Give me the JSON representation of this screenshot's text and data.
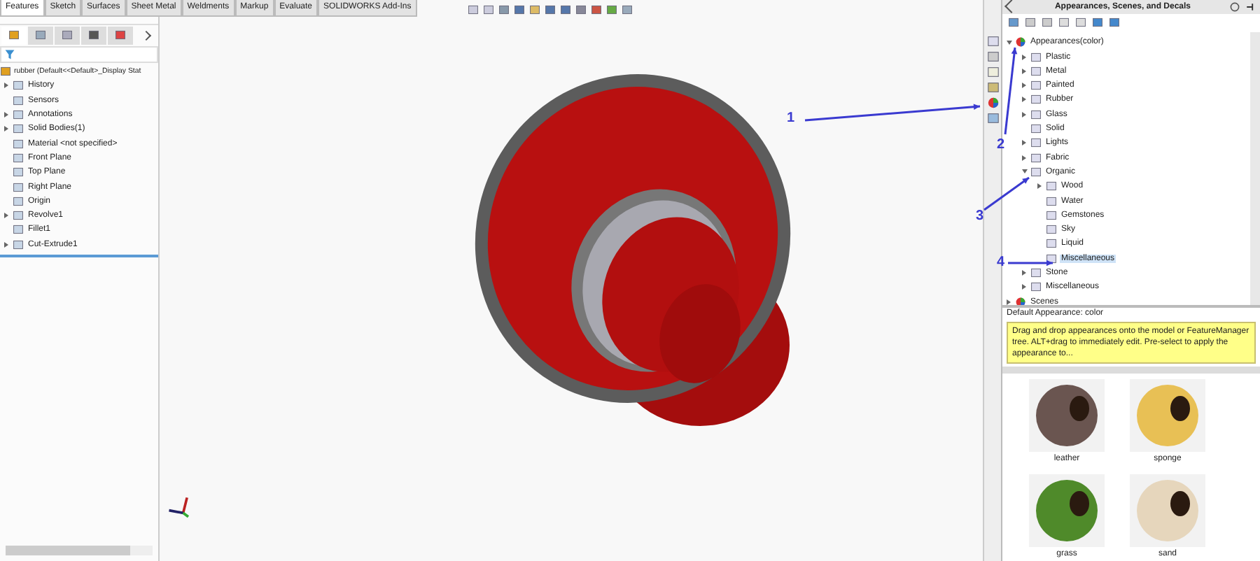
{
  "command_tabs": [
    {
      "label": "Features",
      "selected": true
    },
    {
      "label": "Sketch",
      "selected": false
    },
    {
      "label": "Surfaces",
      "selected": false
    },
    {
      "label": "Sheet Metal",
      "selected": false
    },
    {
      "label": "Weldments",
      "selected": false
    },
    {
      "label": "Markup",
      "selected": false
    },
    {
      "label": "Evaluate",
      "selected": false
    },
    {
      "label": "SOLIDWORKS Add-Ins",
      "selected": false
    }
  ],
  "feature_tree": {
    "root": "rubber  (Default<<Default>_Display Stat",
    "items": [
      {
        "label": "History",
        "kind": "collapsed"
      },
      {
        "label": "Sensors",
        "kind": "leaf"
      },
      {
        "label": "Annotations",
        "kind": "collapsed"
      },
      {
        "label": "Solid Bodies(1)",
        "kind": "collapsed"
      },
      {
        "label": "Material <not specified>",
        "kind": "leaf"
      },
      {
        "label": "Front Plane",
        "kind": "leaf"
      },
      {
        "label": "Top Plane",
        "kind": "leaf"
      },
      {
        "label": "Right Plane",
        "kind": "leaf"
      },
      {
        "label": "Origin",
        "kind": "leaf"
      },
      {
        "label": "Revolve1",
        "kind": "collapsed"
      },
      {
        "label": "Fillet1",
        "kind": "leaf"
      },
      {
        "label": "Cut-Extrude1",
        "kind": "collapsed"
      }
    ]
  },
  "appearance_pane": {
    "title": "Appearances, Scenes, and Decals",
    "tree": [
      {
        "label": "Appearances(color)",
        "kind": "expanded",
        "children": [
          {
            "label": "Plastic",
            "kind": "collapsed"
          },
          {
            "label": "Metal",
            "kind": "collapsed"
          },
          {
            "label": "Painted",
            "kind": "collapsed"
          },
          {
            "label": "Rubber",
            "kind": "collapsed"
          },
          {
            "label": "Glass",
            "kind": "collapsed"
          },
          {
            "label": "Solid",
            "kind": "leaf"
          },
          {
            "label": "Lights",
            "kind": "collapsed"
          },
          {
            "label": "Fabric",
            "kind": "collapsed"
          },
          {
            "label": "Organic",
            "kind": "expanded",
            "children": [
              {
                "label": "Wood",
                "kind": "collapsed"
              },
              {
                "label": "Water",
                "kind": "leaf"
              },
              {
                "label": "Gemstones",
                "kind": "leaf"
              },
              {
                "label": "Sky",
                "kind": "leaf"
              },
              {
                "label": "Liquid",
                "kind": "leaf"
              },
              {
                "label": "Miscellaneous",
                "kind": "leaf",
                "selected": true
              }
            ]
          },
          {
            "label": "Stone",
            "kind": "collapsed"
          },
          {
            "label": "Miscellaneous",
            "kind": "collapsed"
          }
        ]
      },
      {
        "label": "Scenes",
        "kind": "collapsed"
      }
    ],
    "status": "Default Appearance: color",
    "tip": "Drag and drop appearances onto the model or FeatureManager tree. ALT+drag to immediately edit.  Pre-select to apply the appearance to...",
    "swatches": [
      {
        "label": "leather",
        "color": "#6a5550"
      },
      {
        "label": "sponge",
        "color": "#e8c055"
      },
      {
        "label": "grass",
        "color": "#4f8a2a"
      },
      {
        "label": "sand",
        "color": "#e6d6bc"
      }
    ]
  },
  "callouts": [
    {
      "label": "1"
    },
    {
      "label": "2"
    },
    {
      "label": "3"
    },
    {
      "label": "4"
    }
  ]
}
